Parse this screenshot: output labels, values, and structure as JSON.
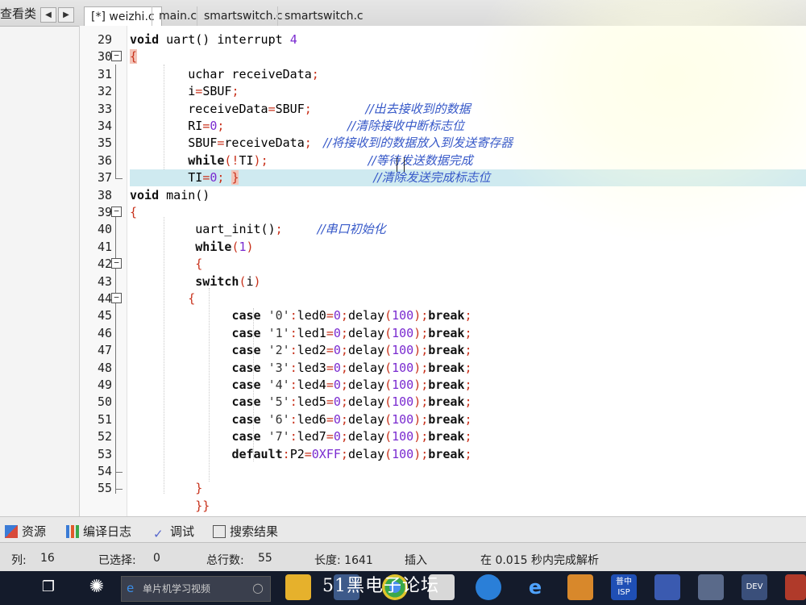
{
  "left_panel": {
    "title": "查看类"
  },
  "tabs": [
    "[*] weizhi.c",
    "main.c",
    "smartswitch.c",
    "smartswitch.c"
  ],
  "active_tab": 0,
  "code_lines": [
    {
      "n": "29",
      "fold": "",
      "seg": [
        [
          "kw",
          "void"
        ],
        [
          "t",
          " uart() "
        ],
        [
          "t",
          "interrupt "
        ],
        [
          "num",
          "4"
        ]
      ]
    },
    {
      "n": "30",
      "fold": "minus",
      "seg": [
        [
          "brace-hl",
          "{"
        ]
      ]
    },
    {
      "n": "31",
      "fold": "",
      "seg": [
        [
          "t",
          "        uchar receiveData"
        ],
        [
          "op",
          ";"
        ]
      ]
    },
    {
      "n": "32",
      "fold": "",
      "seg": [
        [
          "t",
          "        i"
        ],
        [
          "op",
          "="
        ],
        [
          "t",
          "SBUF"
        ],
        [
          "op",
          ";"
        ]
      ]
    },
    {
      "n": "33",
      "fold": "",
      "seg": [
        [
          "t",
          "        receiveData"
        ],
        [
          "op",
          "="
        ],
        [
          "t",
          "SBUF"
        ],
        [
          "op",
          ";"
        ],
        [
          "cmt",
          "              //出去接收到的数据"
        ]
      ]
    },
    {
      "n": "34",
      "fold": "",
      "seg": [
        [
          "t",
          "        RI"
        ],
        [
          "op",
          "="
        ],
        [
          "num",
          "0"
        ],
        [
          "op",
          ";"
        ],
        [
          "cmt",
          "                                //清除接收中断标志位"
        ]
      ]
    },
    {
      "n": "35",
      "fold": "",
      "seg": [
        [
          "t",
          "        SBUF"
        ],
        [
          "op",
          "="
        ],
        [
          "t",
          "receiveData"
        ],
        [
          "op",
          ";"
        ],
        [
          "cmt",
          "   //将接收到的数据放入到发送寄存器"
        ]
      ]
    },
    {
      "n": "36",
      "fold": "",
      "seg": [
        [
          "t",
          "        "
        ],
        [
          "kw",
          "while"
        ],
        [
          "op",
          "(!"
        ],
        [
          "t",
          "TI"
        ],
        [
          "op",
          ")"
        ],
        [
          "op",
          ";"
        ],
        [
          "cmt",
          "                          //等待发送数据完成"
        ]
      ]
    },
    {
      "n": "37",
      "fold": "end",
      "hl": true,
      "seg": [
        [
          "t",
          "        TI"
        ],
        [
          "op",
          "="
        ],
        [
          "num",
          "0"
        ],
        [
          "op",
          ";"
        ],
        [
          "t",
          " "
        ],
        [
          "brace-hl",
          "}"
        ],
        [
          "cmt",
          "                                   //清除发送完成标志位"
        ]
      ]
    },
    {
      "n": "38",
      "fold": "",
      "seg": [
        [
          "kw",
          "void"
        ],
        [
          "t",
          " main()"
        ]
      ]
    },
    {
      "n": "39",
      "fold": "minus",
      "seg": [
        [
          "op",
          "{"
        ]
      ]
    },
    {
      "n": "40",
      "fold": "",
      "seg": [
        [
          "t",
          "         uart_init()"
        ],
        [
          "op",
          ";"
        ],
        [
          "cmt",
          "         //串口初始化"
        ]
      ]
    },
    {
      "n": "41",
      "fold": "",
      "seg": [
        [
          "t",
          "         "
        ],
        [
          "kw",
          "while"
        ],
        [
          "op",
          "("
        ],
        [
          "num",
          "1"
        ],
        [
          "op",
          ")"
        ]
      ]
    },
    {
      "n": "42",
      "fold": "minus",
      "seg": [
        [
          "t",
          "         "
        ],
        [
          "op",
          "{"
        ]
      ]
    },
    {
      "n": "43",
      "fold": "",
      "seg": [
        [
          "t",
          "         "
        ],
        [
          "kw",
          "switch"
        ],
        [
          "op",
          "("
        ],
        [
          "t",
          "i"
        ],
        [
          "op",
          ")"
        ]
      ]
    },
    {
      "n": "44",
      "fold": "minus",
      "seg": [
        [
          "t",
          "        "
        ],
        [
          "op",
          "{"
        ]
      ]
    },
    {
      "n": "45",
      "fold": "",
      "seg": [
        [
          "t",
          "              "
        ],
        [
          "kw",
          "case"
        ],
        [
          "t",
          " "
        ],
        [
          "str",
          "'0'"
        ],
        [
          "op",
          ":"
        ],
        [
          "t",
          "led0"
        ],
        [
          "op",
          "="
        ],
        [
          "num",
          "0"
        ],
        [
          "op",
          ";"
        ],
        [
          "t",
          "delay"
        ],
        [
          "op",
          "("
        ],
        [
          "num",
          "100"
        ],
        [
          "op",
          ")"
        ],
        [
          "op",
          ";"
        ],
        [
          "kw",
          "break"
        ],
        [
          "op",
          ";"
        ]
      ]
    },
    {
      "n": "46",
      "fold": "",
      "seg": [
        [
          "t",
          "              "
        ],
        [
          "kw",
          "case"
        ],
        [
          "t",
          " "
        ],
        [
          "str",
          "'1'"
        ],
        [
          "op",
          ":"
        ],
        [
          "t",
          "led1"
        ],
        [
          "op",
          "="
        ],
        [
          "num",
          "0"
        ],
        [
          "op",
          ";"
        ],
        [
          "t",
          "delay"
        ],
        [
          "op",
          "("
        ],
        [
          "num",
          "100"
        ],
        [
          "op",
          ")"
        ],
        [
          "op",
          ";"
        ],
        [
          "kw",
          "break"
        ],
        [
          "op",
          ";"
        ]
      ]
    },
    {
      "n": "47",
      "fold": "",
      "seg": [
        [
          "t",
          "              "
        ],
        [
          "kw",
          "case"
        ],
        [
          "t",
          " "
        ],
        [
          "str",
          "'2'"
        ],
        [
          "op",
          ":"
        ],
        [
          "t",
          "led2"
        ],
        [
          "op",
          "="
        ],
        [
          "num",
          "0"
        ],
        [
          "op",
          ";"
        ],
        [
          "t",
          "delay"
        ],
        [
          "op",
          "("
        ],
        [
          "num",
          "100"
        ],
        [
          "op",
          ")"
        ],
        [
          "op",
          ";"
        ],
        [
          "kw",
          "break"
        ],
        [
          "op",
          ";"
        ]
      ]
    },
    {
      "n": "48",
      "fold": "",
      "seg": [
        [
          "t",
          "              "
        ],
        [
          "kw",
          "case"
        ],
        [
          "t",
          " "
        ],
        [
          "str",
          "'3'"
        ],
        [
          "op",
          ":"
        ],
        [
          "t",
          "led3"
        ],
        [
          "op",
          "="
        ],
        [
          "num",
          "0"
        ],
        [
          "op",
          ";"
        ],
        [
          "t",
          "delay"
        ],
        [
          "op",
          "("
        ],
        [
          "num",
          "100"
        ],
        [
          "op",
          ")"
        ],
        [
          "op",
          ";"
        ],
        [
          "kw",
          "break"
        ],
        [
          "op",
          ";"
        ]
      ]
    },
    {
      "n": "49",
      "fold": "",
      "seg": [
        [
          "t",
          "              "
        ],
        [
          "kw",
          "case"
        ],
        [
          "t",
          " "
        ],
        [
          "str",
          "'4'"
        ],
        [
          "op",
          ":"
        ],
        [
          "t",
          "led4"
        ],
        [
          "op",
          "="
        ],
        [
          "num",
          "0"
        ],
        [
          "op",
          ";"
        ],
        [
          "t",
          "delay"
        ],
        [
          "op",
          "("
        ],
        [
          "num",
          "100"
        ],
        [
          "op",
          ")"
        ],
        [
          "op",
          ";"
        ],
        [
          "kw",
          "break"
        ],
        [
          "op",
          ";"
        ]
      ]
    },
    {
      "n": "50",
      "fold": "",
      "seg": [
        [
          "t",
          "              "
        ],
        [
          "kw",
          "case"
        ],
        [
          "t",
          " "
        ],
        [
          "str",
          "'5'"
        ],
        [
          "op",
          ":"
        ],
        [
          "t",
          "led5"
        ],
        [
          "op",
          "="
        ],
        [
          "num",
          "0"
        ],
        [
          "op",
          ";"
        ],
        [
          "t",
          "delay"
        ],
        [
          "op",
          "("
        ],
        [
          "num",
          "100"
        ],
        [
          "op",
          ")"
        ],
        [
          "op",
          ";"
        ],
        [
          "kw",
          "break"
        ],
        [
          "op",
          ";"
        ]
      ]
    },
    {
      "n": "51",
      "fold": "",
      "seg": [
        [
          "t",
          "              "
        ],
        [
          "kw",
          "case"
        ],
        [
          "t",
          " "
        ],
        [
          "str",
          "'6'"
        ],
        [
          "op",
          ":"
        ],
        [
          "t",
          "led6"
        ],
        [
          "op",
          "="
        ],
        [
          "num",
          "0"
        ],
        [
          "op",
          ";"
        ],
        [
          "t",
          "delay"
        ],
        [
          "op",
          "("
        ],
        [
          "num",
          "100"
        ],
        [
          "op",
          ")"
        ],
        [
          "op",
          ";"
        ],
        [
          "kw",
          "break"
        ],
        [
          "op",
          ";"
        ]
      ]
    },
    {
      "n": "52",
      "fold": "",
      "seg": [
        [
          "t",
          "              "
        ],
        [
          "kw",
          "case"
        ],
        [
          "t",
          " "
        ],
        [
          "str",
          "'7'"
        ],
        [
          "op",
          ":"
        ],
        [
          "t",
          "led7"
        ],
        [
          "op",
          "="
        ],
        [
          "num",
          "0"
        ],
        [
          "op",
          ";"
        ],
        [
          "t",
          "delay"
        ],
        [
          "op",
          "("
        ],
        [
          "num",
          "100"
        ],
        [
          "op",
          ")"
        ],
        [
          "op",
          ";"
        ],
        [
          "kw",
          "break"
        ],
        [
          "op",
          ";"
        ]
      ]
    },
    {
      "n": "53",
      "fold": "",
      "seg": [
        [
          "t",
          "              "
        ],
        [
          "kw",
          "default"
        ],
        [
          "op",
          ":"
        ],
        [
          "t",
          "P2"
        ],
        [
          "op",
          "="
        ],
        [
          "num",
          "0XFF"
        ],
        [
          "op",
          ";"
        ],
        [
          "t",
          "delay"
        ],
        [
          "op",
          "("
        ],
        [
          "num",
          "100"
        ],
        [
          "op",
          ")"
        ],
        [
          "op",
          ";"
        ],
        [
          "kw",
          "break"
        ],
        [
          "op",
          ";"
        ]
      ]
    },
    {
      "n": "54",
      "fold": "end",
      "seg": []
    },
    {
      "n": "55",
      "fold": "end",
      "seg": [
        [
          "t",
          "         "
        ],
        [
          "op",
          "}"
        ]
      ]
    },
    {
      "n": "",
      "fold": "",
      "seg": [
        [
          "t",
          "         "
        ],
        [
          "op",
          "}}"
        ]
      ]
    }
  ],
  "panel_tabs": [
    "资源",
    "编译日志",
    "调试",
    "搜索结果"
  ],
  "status": {
    "col_label": "列:",
    "col_value": "16",
    "sel_label": "已选择:",
    "sel_value": "0",
    "lines_label": "总行数:",
    "lines_value": "55",
    "length": "长度: 1641",
    "mode": "插入",
    "message": "在 0.015 秒内完成解析"
  },
  "taskbar": {
    "search_text": "单片机学习视频",
    "icons": [
      "folder-icon",
      "store-icon",
      "chrome-icon",
      "box-icon",
      "edge-icon",
      "edge-icon",
      "archive-icon",
      "isp-icon",
      "keil-icon",
      "building-icon",
      "dev-icon",
      "game-icon"
    ],
    "isp_label": "普中\nISP",
    "dev_label": "DEV"
  },
  "watermark": "51黑电子论坛",
  "colors": {
    "comment": "#3658c8",
    "number": "#7a2bd0",
    "operator": "#c8321c",
    "highlight": "#cfeaf0",
    "taskbar": "#141b2b"
  }
}
